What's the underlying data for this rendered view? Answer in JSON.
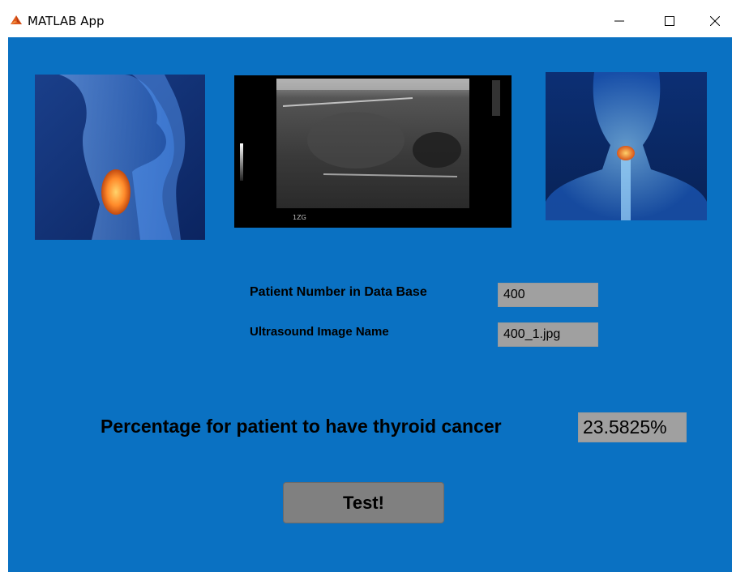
{
  "window": {
    "title": "MATLAB App",
    "icons": {
      "app": "matlab-icon",
      "minimize": "minimize-icon",
      "maximize": "maximize-icon",
      "close": "close-icon"
    }
  },
  "images": {
    "left": "thyroid-side-illustration",
    "center": "ultrasound-scan-image",
    "right": "thyroid-front-illustration"
  },
  "ultrasound": {
    "scale_label": "1ZG"
  },
  "form": {
    "patient_label": "Patient Number in Data Base",
    "patient_value": "400",
    "image_label": "Ultrasound Image Name",
    "image_value": "400_1.jpg"
  },
  "result": {
    "label": "Percentage for patient to have thyroid cancer",
    "value": "23.5825%"
  },
  "actions": {
    "test_label": "Test!"
  },
  "colors": {
    "background": "#0a71c2",
    "field": "#a0a0a0",
    "button": "#808080"
  }
}
